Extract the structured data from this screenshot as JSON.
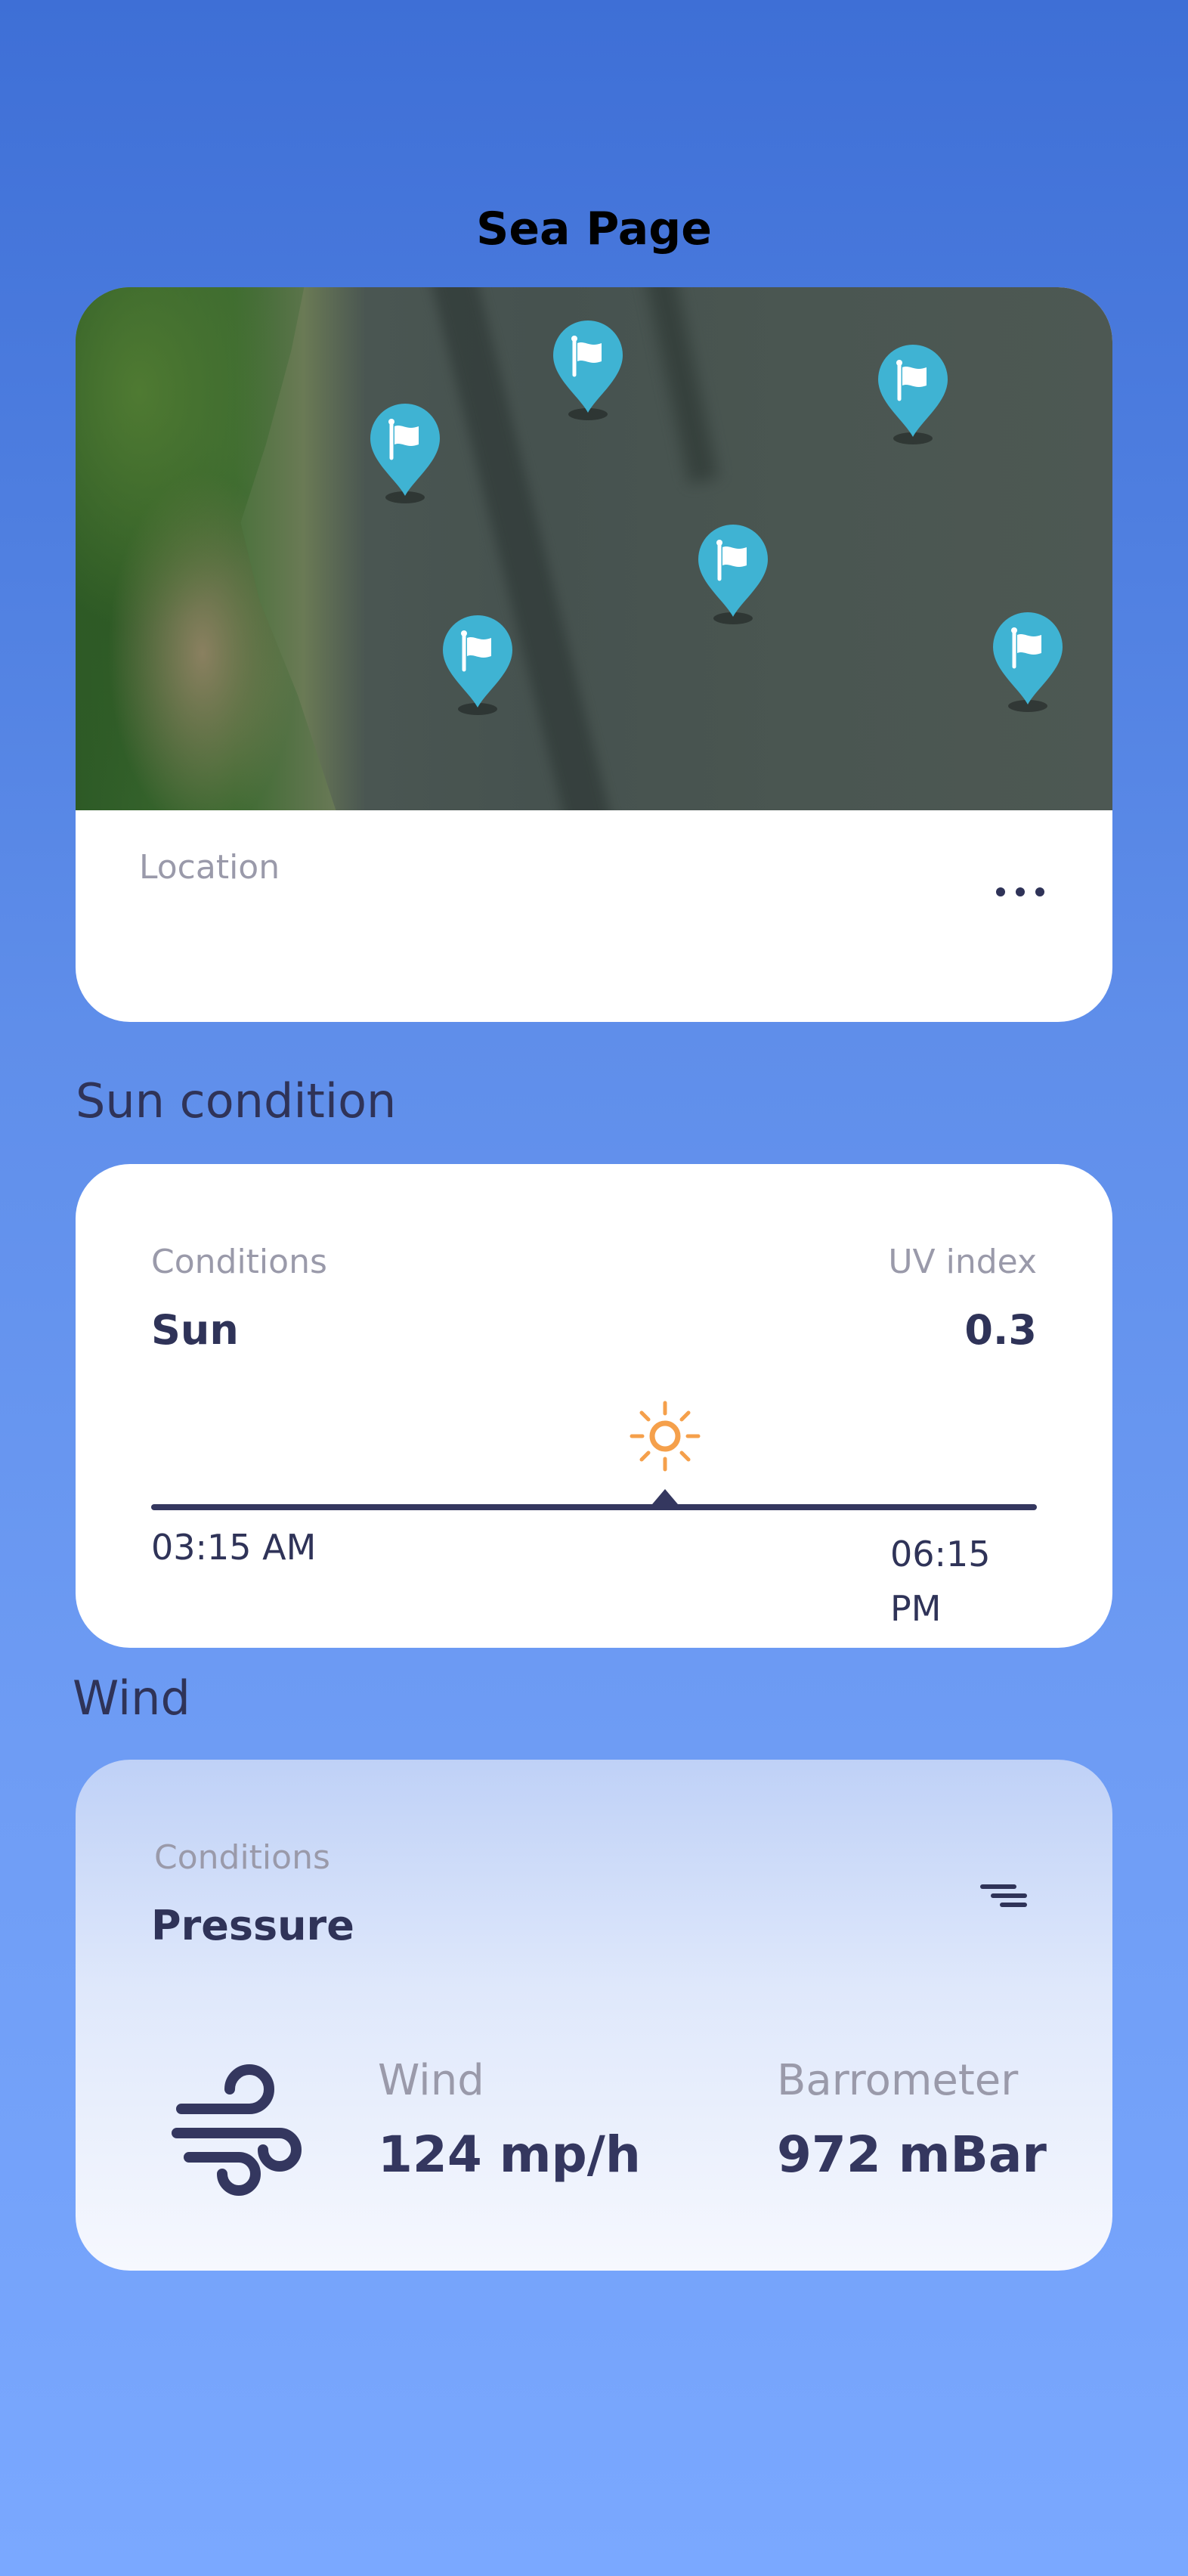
{
  "page": {
    "title": "Sea Page"
  },
  "map_card": {
    "location_label": "Location",
    "pins": [
      "flag-pin",
      "flag-pin",
      "flag-pin",
      "flag-pin",
      "flag-pin",
      "flag-pin"
    ],
    "more_icon": "more-horizontal-icon"
  },
  "sun_section": {
    "heading": "Sun condition",
    "conditions_label": "Conditions",
    "conditions_value": "Sun",
    "uv_label": "UV index",
    "uv_value": "0.3",
    "sunrise": "03:15 AM",
    "sunset": "06:15 PM",
    "day_progress": 0.58,
    "sun_icon": "sun-icon"
  },
  "wind_section": {
    "heading": "Wind",
    "conditions_label": "Conditions",
    "conditions_value": "Pressure",
    "wind_label": "Wind",
    "wind_value": "124 mp/h",
    "barometer_label": "Barrometer",
    "barometer_value": "972 mBar",
    "filter_icon": "filter-icon",
    "wind_icon": "wind-icon"
  },
  "colors": {
    "background_top": "#3e6fd6",
    "background_bottom": "#7aa8ff",
    "pin": "#3fb3d3",
    "sun": "#f5a04b",
    "text_dark": "#2f3358",
    "text_muted": "#9a9aaa"
  }
}
